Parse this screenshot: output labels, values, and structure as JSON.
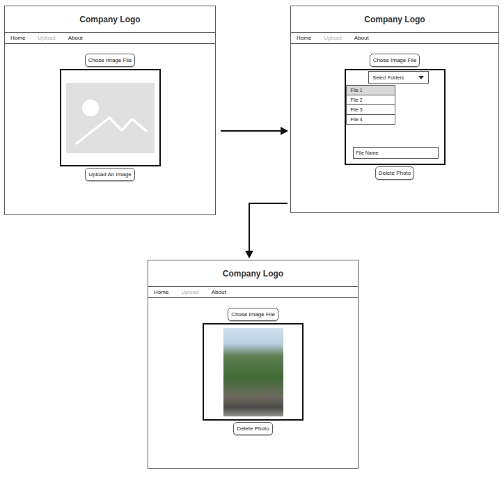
{
  "screens": [
    {
      "logo": "Company Logo",
      "nav": [
        {
          "label": "Home",
          "disabled": false
        },
        {
          "label": "Upload",
          "disabled": true
        },
        {
          "label": "About",
          "disabled": false
        }
      ],
      "choose_button": "Chose Image File",
      "content": {
        "kind": "placeholder"
      },
      "action_button": "Upload An Image"
    },
    {
      "logo": "Company Logo",
      "nav": [
        {
          "label": "Home",
          "disabled": false
        },
        {
          "label": "Upload",
          "disabled": true
        },
        {
          "label": "About",
          "disabled": false
        }
      ],
      "choose_button": "Chose Image File",
      "content": {
        "kind": "picker",
        "dropdown": "Select Folders",
        "files": [
          {
            "label": "File 1",
            "selected": true
          },
          {
            "label": "File 2",
            "selected": false
          },
          {
            "label": "File 3",
            "selected": false
          },
          {
            "label": "File 4",
            "selected": false
          }
        ],
        "field_placeholder": "File Name"
      },
      "action_button": "Delete Photo"
    },
    {
      "logo": "Company Logo",
      "nav": [
        {
          "label": "Home",
          "disabled": false
        },
        {
          "label": "Upload",
          "disabled": true
        },
        {
          "label": "About",
          "disabled": false
        }
      ],
      "choose_button": "Chose Image File",
      "content": {
        "kind": "photo"
      },
      "action_button": "Delete Photo"
    }
  ]
}
